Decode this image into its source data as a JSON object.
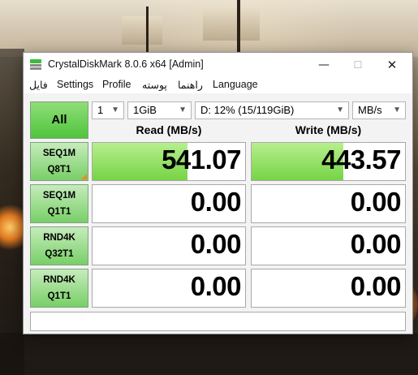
{
  "window": {
    "title": "CrystalDiskMark 8.0.6 x64 [Admin]",
    "controls": {
      "minimize": "—",
      "maximize": "☐",
      "close": "✕"
    }
  },
  "menu": [
    "فایل",
    "Settings",
    "Profile",
    "پوسته",
    "راهنما",
    "Language"
  ],
  "controls": {
    "all_label": "All",
    "count": "1",
    "size": "1GiB",
    "drive": "D: 12% (15/119GiB)",
    "unit": "MB/s"
  },
  "headers": {
    "read": "Read (MB/s)",
    "write": "Write (MB/s)"
  },
  "tests": [
    {
      "line1": "SEQ1M",
      "line2": "Q8T1",
      "read": "541.07",
      "write": "443.57",
      "read_fill": 0.62,
      "write_fill": 0.6
    },
    {
      "line1": "SEQ1M",
      "line2": "Q1T1",
      "read": "0.00",
      "write": "0.00",
      "read_fill": 0,
      "write_fill": 0
    },
    {
      "line1": "RND4K",
      "line2": "Q32T1",
      "read": "0.00",
      "write": "0.00",
      "read_fill": 0,
      "write_fill": 0
    },
    {
      "line1": "RND4K",
      "line2": "Q1T1",
      "read": "0.00",
      "write": "0.00",
      "read_fill": 0,
      "write_fill": 0
    }
  ],
  "comment": "",
  "colors": {
    "button_green": "#4fc43c",
    "bar_green": "#76d445",
    "progress_mark": "#f08a1c"
  }
}
